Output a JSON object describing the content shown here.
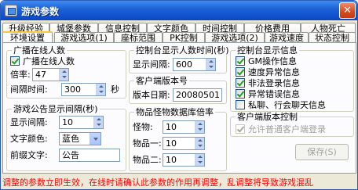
{
  "window": {
    "title": "游戏参数",
    "close_glyph": "✕"
  },
  "tabs_row1": [
    "升级经验",
    "城堡参数",
    "信息控制",
    "文字颜色",
    "时间控制",
    "价格费用",
    "人物死亡"
  ],
  "tabs_row2": [
    "环境设置",
    "游戏选项(1)",
    "座标范围",
    "PK控制",
    "游戏选项(2)",
    "游戏速度",
    "状态控制"
  ],
  "active_tab": "环境设置",
  "broadcast_online": {
    "title": "广播在线人数",
    "checkbox_label": "广播在线人数",
    "checked": true,
    "ratio_label": "倍率:",
    "ratio_value": "47",
    "interval_label": "间隔时间:",
    "interval_value": "300",
    "interval_unit": "秒"
  },
  "announcement": {
    "title": "游戏公告显示间隔(秒)",
    "interval_label": "显示间隔:",
    "interval_value": "10",
    "color_label": "文字颜色:",
    "color_value": "蓝色",
    "prefix_label": "前缀文字:",
    "prefix_value": "公告"
  },
  "console_online": {
    "title": "控制台显示人数时间(秒)",
    "interval_label": "显示间隔:",
    "interval_value": "600"
  },
  "client_version": {
    "title": "客户端版本号",
    "date_label": "版本日期:",
    "date_value": "20080501"
  },
  "monster_drop": {
    "title": "物品怪物数据库倍率",
    "monster_label": "怪物:",
    "monster_value": "10",
    "item1_label": "物品一:",
    "item1_value": "10",
    "item2_label": "物品二:",
    "item2_value": "10"
  },
  "console_info": {
    "title": "控制台显示信息",
    "options": [
      {
        "label": "GM操作信息",
        "checked": true
      },
      {
        "label": "速度异常信息",
        "checked": true
      },
      {
        "label": "非法登录信息",
        "checked": true
      },
      {
        "label": "异常错误信息",
        "checked": true
      },
      {
        "label": "私聊、行会聊天信息",
        "checked": false
      }
    ]
  },
  "client_control": {
    "title": "客户端版本控制",
    "checkbox_label": "允许普通客户端登录",
    "checked": true,
    "enabled": false
  },
  "save_button": {
    "label": "保存(S)",
    "enabled": false
  },
  "status_text": "调整的参数立即生效，在线时请确认此参数的作用再调整，乱调整将导致游戏混乱",
  "colors": {
    "title_bar": "#0e4fcc",
    "status_text": "#ff0000",
    "tab_highlight": "#ffc83c"
  },
  "icons": {
    "close": "close-icon",
    "app": "app-icon"
  }
}
